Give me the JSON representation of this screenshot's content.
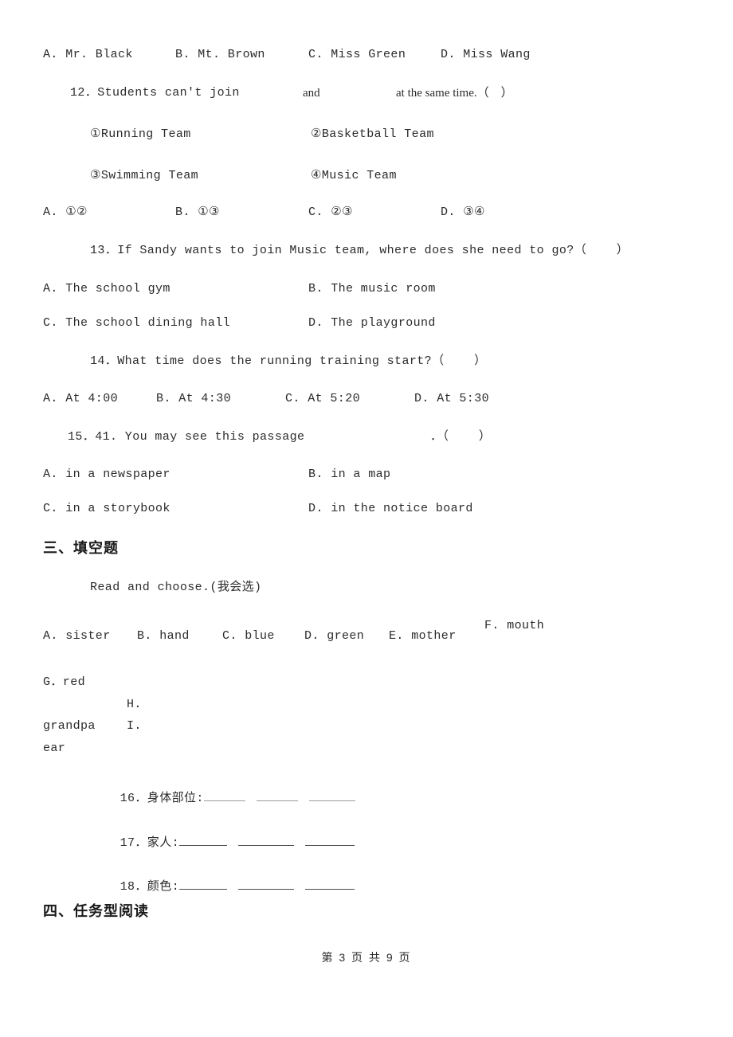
{
  "document": {
    "page_label": "第 3 页 共 9 页",
    "page_number": "3",
    "total_pages": "9",
    "text_color": "#2b2b2b",
    "background_color": "#ffffff"
  },
  "q11_options": {
    "a": "A. Mr. Black",
    "b": "B. Mt. Brown",
    "c": "C. Miss Green",
    "d": "D. Miss Wang"
  },
  "q12": {
    "stem_start": "12．Students can't join",
    "stem_and": "and",
    "stem_end": "at the same time.（    ）",
    "items": {
      "i1": "①Running Team",
      "i2": "②Basketball Team",
      "i3": "③Swimming Team",
      "i4": "④Music Team"
    },
    "options": {
      "a": "A. ①②",
      "b": "B. ①③",
      "c": "C. ②③",
      "d": "D. ③④"
    }
  },
  "q13": {
    "stem": "13．If Sandy wants to join Music team, where does she need to go?（    ）",
    "options": {
      "a": "A. The school gym",
      "b": "B. The music room",
      "c": "C. The school dining hall",
      "d": "D. The playground"
    }
  },
  "q14": {
    "stem": "14．What time does the running training start?（    ）",
    "options": {
      "a": "A. At 4:00",
      "b": "B. At 4:30",
      "c": "C. At 5:20",
      "d": "D. At 5:30"
    }
  },
  "q15": {
    "stem": "15．41. You may see this passage",
    "stem_tail": "．（    ）",
    "options": {
      "a": "A. in a newspaper",
      "b": "B. in a map",
      "c": "C. in a storybook",
      "d": "D. in the notice board"
    }
  },
  "section3": {
    "heading": "三、填空题",
    "instruction": "Read and choose.(我会选)",
    "word_bank": {
      "a": "A. sister",
      "b": "B. hand",
      "c": "C. blue",
      "d": "D. green",
      "e": "E. mother",
      "f": "F. mouth",
      "g": "G．red",
      "h_label": "H.",
      "h_word": "grandpa",
      "i_label": "I.",
      "i_word": "ear"
    },
    "fill_questions": {
      "q16": "16．身体部位:",
      "q17": "17．家人:",
      "q18": "18．颜色:"
    }
  },
  "section4": {
    "heading": "四、任务型阅读"
  }
}
